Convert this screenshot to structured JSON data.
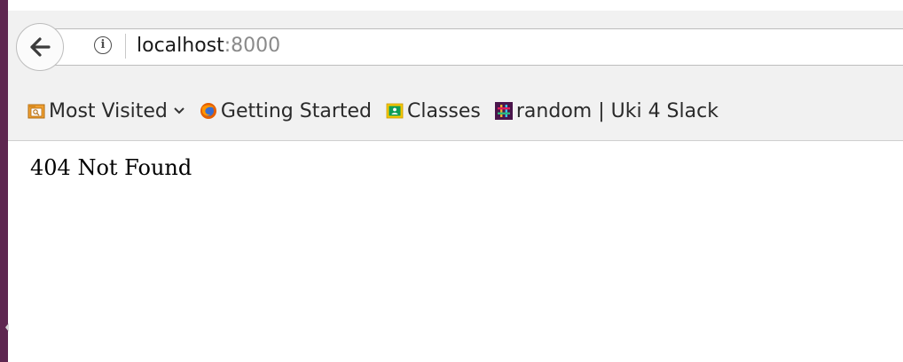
{
  "address_bar": {
    "host": "localhost",
    "port": ":8000",
    "info_icon": "info-icon",
    "back_icon": "back-arrow-icon"
  },
  "bookmarks_toolbar": {
    "items": [
      {
        "label": "Most Visited",
        "icon": "folder-icon",
        "has_dropdown": true
      },
      {
        "label": "Getting Started",
        "icon": "firefox-icon"
      },
      {
        "label": "Classes",
        "icon": "google-classroom-icon"
      },
      {
        "label": "random | Uki 4 Slack",
        "icon": "slack-icon"
      }
    ]
  },
  "page": {
    "message": "404 Not Found"
  },
  "colors": {
    "window_border": "#5e2750",
    "toolbar_bg": "#f1f1f1",
    "port_text": "#8a8a8a"
  }
}
